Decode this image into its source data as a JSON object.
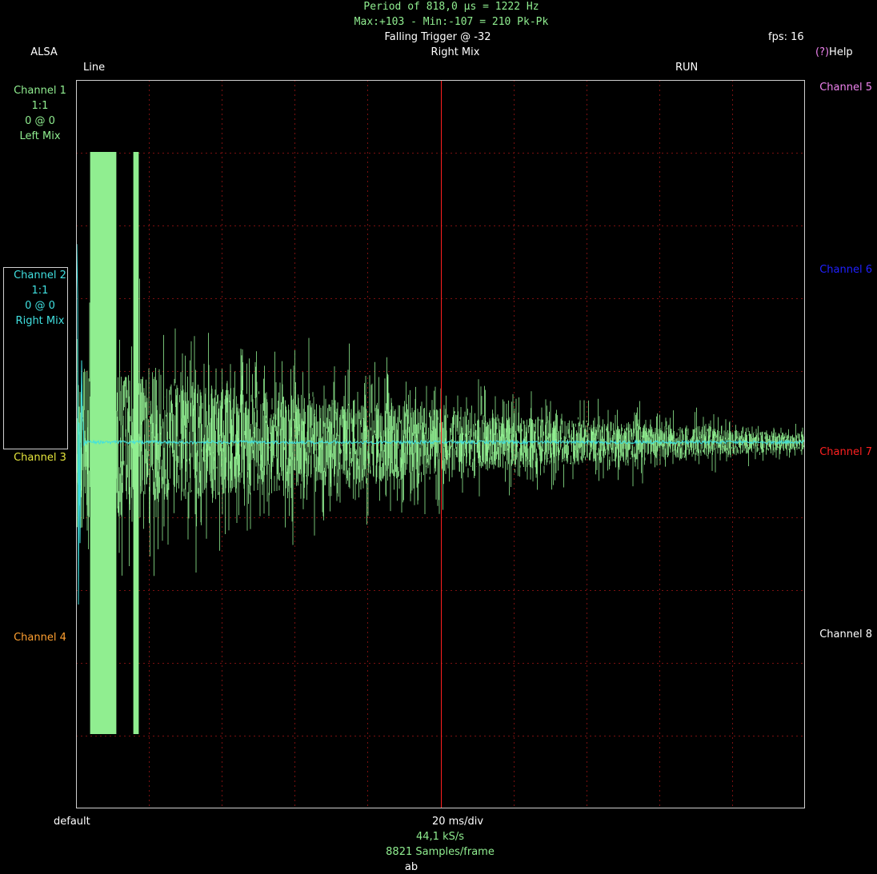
{
  "header": {
    "period_line": "Period of 818,0 µs =  1222 Hz",
    "maxmin_line": "Max:+103 - Min:-107 = 210 Pk-Pk",
    "trigger": "Falling Trigger @ -32",
    "fps": "fps: 16",
    "source": "ALSA",
    "trigger_channel": "Right Mix",
    "help_prefix": "(?)",
    "help": "Help",
    "input": "Line",
    "run_state": "RUN"
  },
  "left_channels": [
    {
      "name": "Channel 1",
      "scale": "1:1",
      "offset": "0 @ 0",
      "source": "Left Mix",
      "color": "#90ee90"
    },
    {
      "name": "Channel 2",
      "scale": "1:1",
      "offset": "0 @ 0",
      "source": "Right Mix",
      "color": "#40e0e0"
    },
    {
      "name": "Channel 3",
      "color": "#e6e63c"
    },
    {
      "name": "Channel 4",
      "color": "#ffa030"
    }
  ],
  "right_channels": [
    {
      "name": "Channel 5",
      "color": "#ee82ee"
    },
    {
      "name": "Channel 6",
      "color": "#2020ff"
    },
    {
      "name": "Channel 7",
      "color": "#ff2020"
    },
    {
      "name": "Channel 8",
      "color": "#ffffff"
    }
  ],
  "footer": {
    "preset": "default",
    "timebase": "20 ms/div",
    "sample_rate": "44,1 kS/s",
    "samples": "8821 Samples/frame",
    "mode": "ab"
  },
  "scope": {
    "grid_color": "#7a1010",
    "trigger_line_color": "#ff2020",
    "trace_left_color": "#90ee90",
    "trace_right_color": "#40e0e0"
  }
}
